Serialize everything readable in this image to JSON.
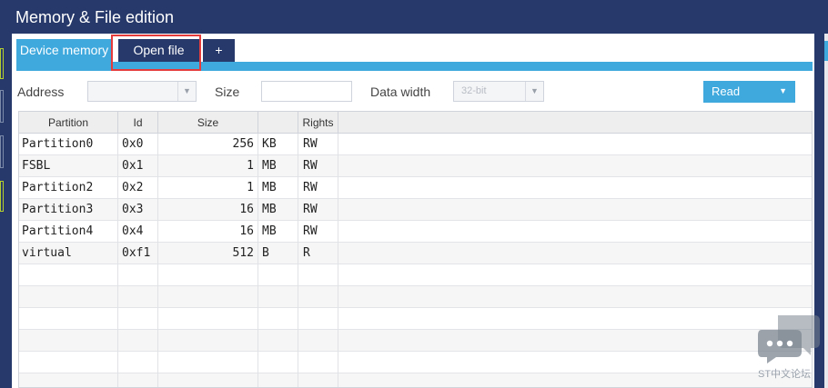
{
  "window": {
    "title": "Memory & File edition"
  },
  "tabs": [
    {
      "label": "Device memory"
    },
    {
      "label": "Open file"
    },
    {
      "label": "+"
    }
  ],
  "toolbar": {
    "address_label": "Address",
    "address_value": "",
    "size_label": "Size",
    "size_value": "",
    "data_width_label": "Data width",
    "data_width_value": "32-bit",
    "read_button": "Read"
  },
  "table": {
    "columns": [
      "Partition",
      "Id",
      "Size",
      "",
      "Rights"
    ],
    "rows": [
      {
        "partition": "Partition0",
        "id": "0x0",
        "size": "256",
        "unit": "KB",
        "rights": "RW"
      },
      {
        "partition": "FSBL",
        "id": "0x1",
        "size": "1",
        "unit": "MB",
        "rights": "RW"
      },
      {
        "partition": "Partition2",
        "id": "0x2",
        "size": "1",
        "unit": "MB",
        "rights": "RW"
      },
      {
        "partition": "Partition3",
        "id": "0x3",
        "size": "16",
        "unit": "MB",
        "rights": "RW"
      },
      {
        "partition": "Partition4",
        "id": "0x4",
        "size": "16",
        "unit": "MB",
        "rights": "RW"
      },
      {
        "partition": "virtual",
        "id": "0xf1",
        "size": "512",
        "unit": "B",
        "rights": "R"
      }
    ]
  },
  "watermark": {
    "text": "ST中文论坛"
  },
  "colors": {
    "navy": "#27396a",
    "accent": "#3fa9de",
    "highlight": "#e53b3b"
  }
}
